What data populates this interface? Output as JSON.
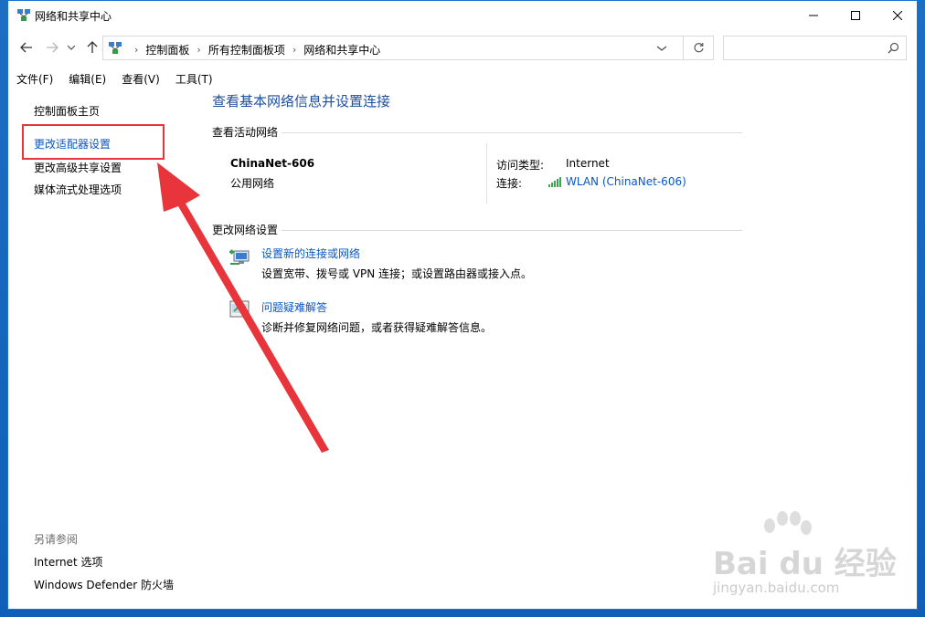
{
  "window": {
    "title": "网络和共享中心"
  },
  "address": {
    "crumbs": [
      "控制面板",
      "所有控制面板项",
      "网络和共享中心"
    ],
    "separator": "›",
    "search_placeholder": ""
  },
  "menubar": {
    "items": [
      "文件(F)",
      "编辑(E)",
      "查看(V)",
      "工具(T)"
    ]
  },
  "left_panel": {
    "links": [
      {
        "label": "控制面板主页",
        "active": false
      },
      {
        "label": "更改适配器设置",
        "active": true
      },
      {
        "label": "更改高级共享设置",
        "active": false
      },
      {
        "label": "媒体流式处理选项",
        "active": false
      }
    ],
    "see_also_label": "另请参阅",
    "see_also_links": [
      "Internet 选项",
      "Windows Defender 防火墙"
    ]
  },
  "main": {
    "title": "查看基本网络信息并设置连接",
    "active_networks_label": "查看活动网络",
    "network": {
      "name": "ChinaNet-606",
      "type": "公用网络",
      "access_type_label": "访问类型:",
      "access_type_value": "Internet",
      "connection_label": "连接:",
      "connection_value": "WLAN (ChinaNet-606)"
    },
    "change_settings_label": "更改网络设置",
    "tasks": [
      {
        "title": "设置新的连接或网络",
        "desc": "设置宽带、拨号或 VPN 连接；或设置路由器或接入点。",
        "icon": "network-setup-icon"
      },
      {
        "title": "问题疑难解答",
        "desc": "诊断并修复网络问题，或者获得疑难解答信息。",
        "icon": "troubleshoot-icon"
      }
    ]
  },
  "colors": {
    "link_blue": "#0a56c5",
    "title_blue": "#1d4f9c",
    "annotation_red": "#e8353b",
    "desktop_blue": "#1a6fc4"
  },
  "watermark": {
    "brand": "Bai du 经验",
    "url": "jingyan.baidu.com"
  }
}
